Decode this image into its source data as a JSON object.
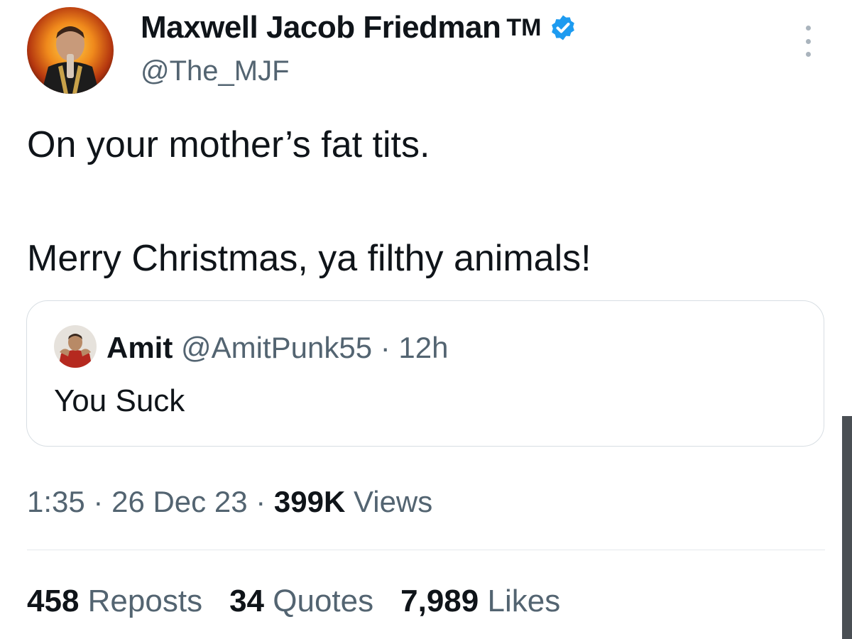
{
  "author": {
    "display_name": "Maxwell Jacob Friedman",
    "trademark": "TM",
    "handle": "@The_MJF",
    "verified_icon": "verified-badge-icon",
    "verified_color": "#1d9bf0"
  },
  "tweet": {
    "line1": "On your mother’s fat tits.",
    "line2": "Merry Christmas, ya filthy animals!"
  },
  "quoted": {
    "name": "Amit",
    "meta": "@AmitPunk55 · 12h",
    "text": "You Suck"
  },
  "meta": {
    "time": "1:35",
    "sep1": "·",
    "date": "26 Dec 23",
    "sep2": "·",
    "views_count": "399K",
    "views_label": "Views"
  },
  "stats": {
    "reposts_count": "458",
    "reposts_label": "Reposts",
    "quotes_count": "34",
    "quotes_label": "Quotes",
    "likes_count": "7,989",
    "likes_label": "Likes"
  },
  "colors": {
    "text_primary": "#0f1419",
    "text_secondary": "#536471",
    "border": "#d8dee3"
  }
}
